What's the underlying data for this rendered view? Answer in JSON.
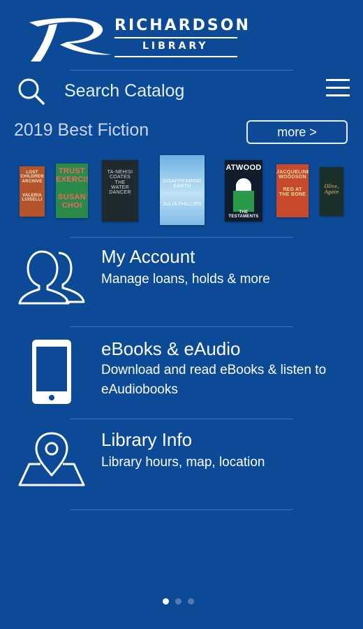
{
  "header": {
    "logo_title": "RICHARDSON",
    "logo_subtitle": "LIBRARY"
  },
  "search": {
    "placeholder": "Search Catalog",
    "icon": "search-icon"
  },
  "menu_icon": "hamburger-menu-icon",
  "best_fiction": {
    "title": "2019 Best Fiction",
    "more_label": "more >",
    "books": [
      {
        "lines": [
          "LOST",
          "CHILDREN",
          "ARCHIVE",
          "VALERIA",
          "LUISELLI"
        ],
        "bg": "#b5542b",
        "fg": "#f3e6d0"
      },
      {
        "lines": [
          "TRUST",
          "EXERCISE",
          "SUSAN",
          "CHOI"
        ],
        "bg": "#2a8a4a",
        "fg": "#ef6a5a"
      },
      {
        "lines": [
          "TA-NEHISI",
          "COATES",
          "THE",
          "WATER",
          "DANCER"
        ],
        "bg": "#1f2a2e",
        "fg": "#d9d9d9"
      },
      {
        "lines": [
          "DISAPPEARING",
          "EARTH",
          "JULIA PHILLIPS"
        ],
        "bg": "#7bbbe6",
        "fg": "#ffffff"
      },
      {
        "lines": [
          "ATWOOD",
          "THE",
          "TESTAMENTS"
        ],
        "bg": "#0f1c2b",
        "fg": "#ffffff"
      },
      {
        "lines": [
          "JACQUELINE",
          "WOODSON",
          "RED AT",
          "THE BONE"
        ],
        "bg": "#c74a2d",
        "fg": "#f4d7a3"
      },
      {
        "lines": [
          "Olive,",
          "Again"
        ],
        "bg": "#1b2f2a",
        "fg": "#e9c36a"
      }
    ]
  },
  "menu_items": [
    {
      "title": "My Account",
      "description": "Manage loans, holds & more",
      "icon": "users-icon"
    },
    {
      "title": "eBooks & eAudio",
      "description": "Download and read eBooks & listen to eAudiobooks",
      "icon": "smartphone-icon"
    },
    {
      "title": "Library Info",
      "description": "Library hours, map, location",
      "icon": "map-location-icon"
    }
  ],
  "pagination": {
    "current": 1,
    "total": 3
  }
}
